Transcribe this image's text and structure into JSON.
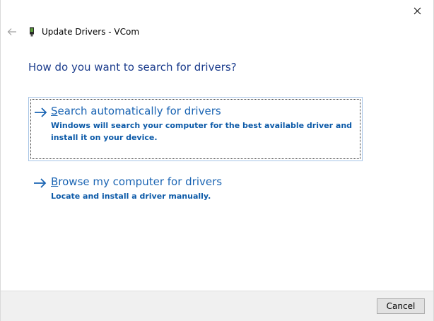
{
  "window": {
    "title": "Update Drivers - VCom",
    "close_icon": "close-icon",
    "back_icon": "back-arrow-icon",
    "device_icon": "device-icon"
  },
  "heading": "How do you want to search for drivers?",
  "options": [
    {
      "title_prefix": "",
      "title_accel": "S",
      "title_rest": "earch automatically for drivers",
      "description": "Windows will search your computer for the best available driver and install it on your device.",
      "icon": "arrow-right-icon"
    },
    {
      "title_prefix": "",
      "title_accel": "B",
      "title_rest": "rowse my computer for drivers",
      "description": "Locate and install a driver manually.",
      "icon": "arrow-right-icon"
    }
  ],
  "footer": {
    "cancel_label": "Cancel"
  },
  "colors": {
    "heading": "#1b3c8c",
    "link": "#1a64b3",
    "footer_bg": "#f0f0f0"
  }
}
